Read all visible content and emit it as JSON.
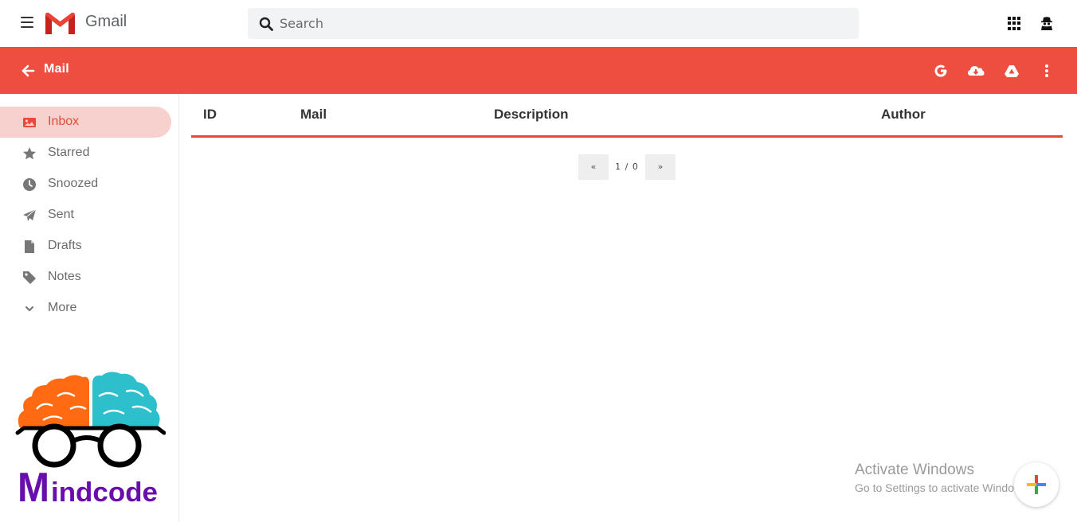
{
  "header": {
    "app_name": "Gmail",
    "search_placeholder": "Search",
    "icons": [
      "menu-icon",
      "gmail-logo-icon",
      "search-icon",
      "apps-grid-icon",
      "account-icon"
    ]
  },
  "toolbar": {
    "title": "Mail",
    "color": "#ee4e3f",
    "icons": [
      "arrow-left-icon",
      "google-icon",
      "cloud-download-icon",
      "google-drive-icon",
      "more-vert-icon"
    ]
  },
  "sidebar": {
    "items": [
      {
        "label": "Inbox",
        "icon": "image-icon",
        "active": true
      },
      {
        "label": "Starred",
        "icon": "star-icon"
      },
      {
        "label": "Snoozed",
        "icon": "clock-icon"
      },
      {
        "label": "Sent",
        "icon": "paper-plane-icon"
      },
      {
        "label": "Drafts",
        "icon": "file-icon"
      },
      {
        "label": "Notes",
        "icon": "tag-icon"
      },
      {
        "label": "More",
        "icon": "chevron-down-icon"
      }
    ],
    "logo_text": "Mindcode"
  },
  "table": {
    "columns": [
      "ID",
      "Mail",
      "Description",
      "Author"
    ],
    "rows": []
  },
  "pagination": {
    "prev": "«",
    "current": "1 / 0",
    "next": "»"
  },
  "watermark": {
    "line1": "Activate Windows",
    "line2": "Go to Settings to activate Windows."
  },
  "colors": {
    "accent": "#e8493a",
    "active_bg": "#f7d1cd",
    "brain_left": "#ff6a13",
    "brain_right": "#2ebfcc",
    "logo_text": "#6a0dad"
  }
}
